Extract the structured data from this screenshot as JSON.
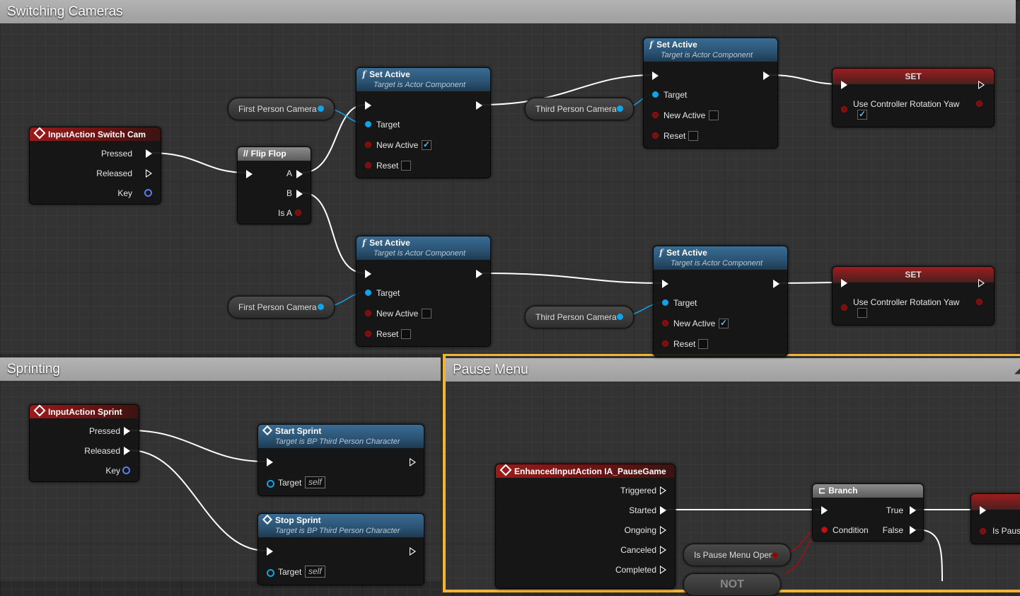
{
  "comments": {
    "switching": "Switching Cameras",
    "sprinting": "Sprinting",
    "pause": "Pause Menu"
  },
  "nodes": {
    "switch_cam": {
      "title": "InputAction Switch Cam",
      "pressed": "Pressed",
      "released": "Released",
      "key": "Key"
    },
    "flipflop": {
      "title": "Flip Flop",
      "a": "A",
      "b": "B",
      "is_a": "Is A"
    },
    "set_active_1": {
      "title": "Set Active",
      "subtitle": "Target is Actor Component",
      "target": "Target",
      "new_active": "New Active",
      "reset": "Reset"
    },
    "set_active_2": {
      "title": "Set Active",
      "subtitle": "Target is Actor Component",
      "target": "Target",
      "new_active": "New Active",
      "reset": "Reset"
    },
    "set_active_3": {
      "title": "Set Active",
      "subtitle": "Target is Actor Component",
      "target": "Target",
      "new_active": "New Active",
      "reset": "Reset"
    },
    "set_active_4": {
      "title": "Set Active",
      "subtitle": "Target is Actor Component",
      "target": "Target",
      "new_active": "New Active",
      "reset": "Reset"
    },
    "set_1": {
      "title": "SET",
      "label": "Use Controller Rotation Yaw"
    },
    "set_2": {
      "title": "SET",
      "label": "Use Controller Rotation Yaw"
    },
    "var_fpc_1": "First Person Camera",
    "var_fpc_2": "First Person Camera",
    "var_tpc_1": "Third Person Camera",
    "var_tpc_2": "Third Person Camera",
    "sprint": {
      "title": "InputAction Sprint",
      "pressed": "Pressed",
      "released": "Released",
      "key": "Key"
    },
    "start_sprint": {
      "title": "Start Sprint",
      "subtitle": "Target is BP Third Person Character",
      "target": "Target",
      "self": "self"
    },
    "stop_sprint": {
      "title": "Stop Sprint",
      "subtitle": "Target is BP Third Person Character",
      "target": "Target",
      "self": "self"
    },
    "pause_game": {
      "title": "EnhancedInputAction IA_PauseGame",
      "triggered": "Triggered",
      "started": "Started",
      "ongoing": "Ongoing",
      "canceled": "Canceled",
      "completed": "Completed"
    },
    "branch": {
      "title": "Branch",
      "true": "True",
      "false": "False",
      "condition": "Condition"
    },
    "var_pause_open": "Is Pause Menu Open",
    "partial_set_label": "Is Pause",
    "partial_not": "NOT"
  },
  "checkbox_states": {
    "set_active_1_new_active": true,
    "set_active_1_reset": false,
    "set_active_2_new_active": false,
    "set_active_2_reset": false,
    "set_active_3_new_active": false,
    "set_active_3_reset": false,
    "set_active_4_new_active": true,
    "set_active_4_reset": false,
    "set_1_yaw": true,
    "set_2_yaw": false
  },
  "colors": {
    "exec_wire": "#ffffff",
    "object_pin": "#12a2e6",
    "bool_pin": "#a41010",
    "selection": "#f2b533"
  }
}
